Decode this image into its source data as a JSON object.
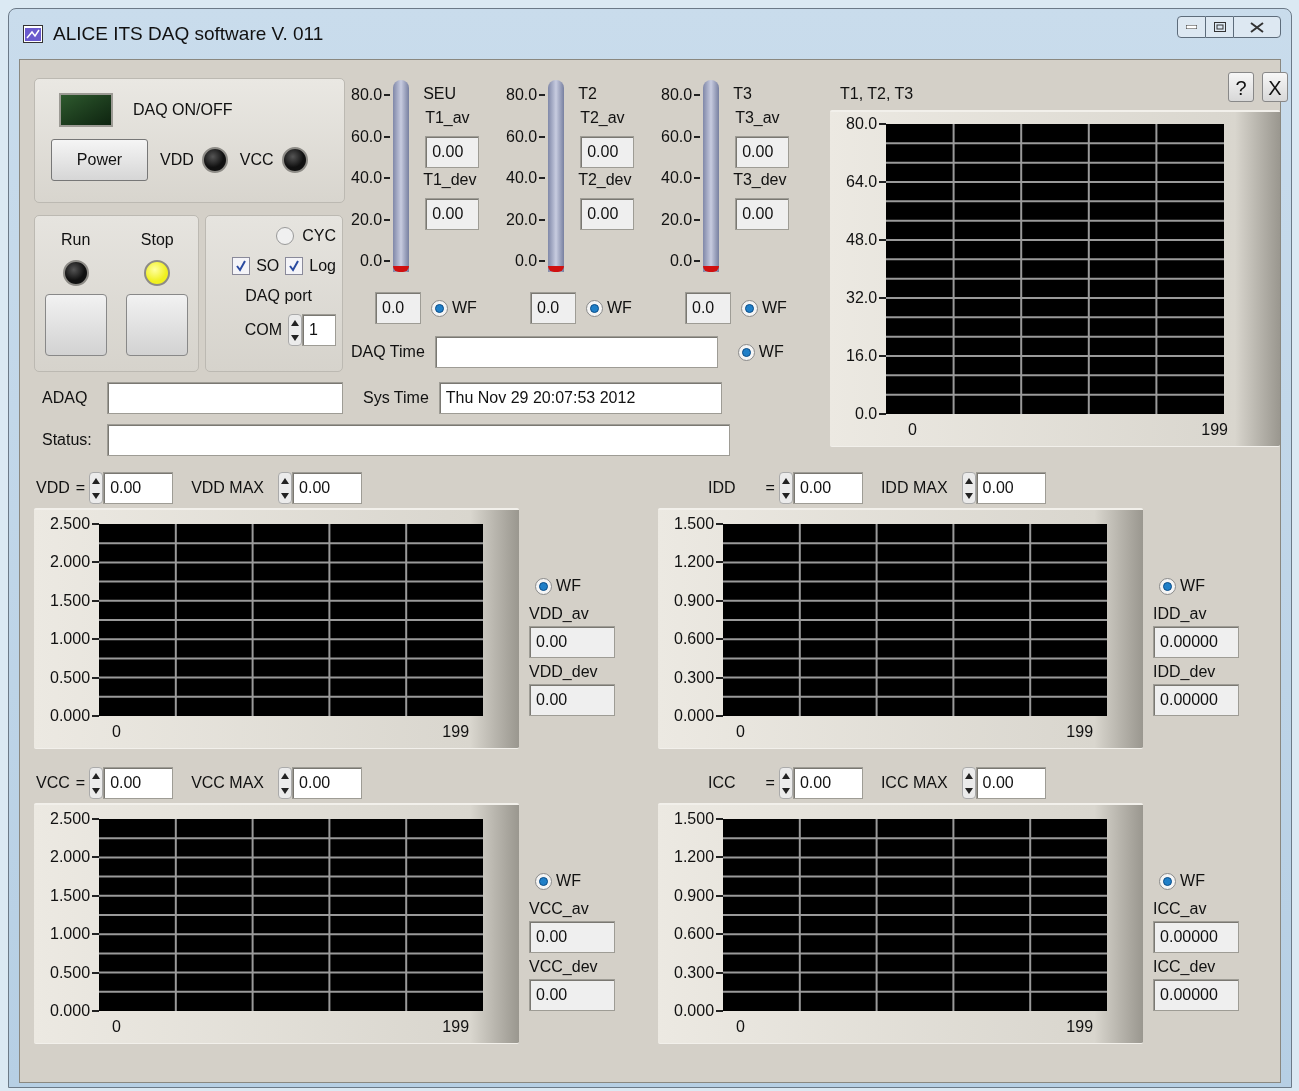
{
  "window": {
    "title": "ALICE ITS DAQ software V. 011"
  },
  "panel_buttons": [
    {
      "label": "?"
    },
    {
      "label": "X"
    }
  ],
  "daq": {
    "led_on": false,
    "label": "DAQ ON/OFF",
    "power_button": "Power",
    "indicators": [
      {
        "label": "VDD",
        "on": false
      },
      {
        "label": "VCC",
        "on": false
      }
    ]
  },
  "run_stop": [
    {
      "label": "Run",
      "lit": false
    },
    {
      "label": "Stop",
      "lit": true
    }
  ],
  "options": {
    "cyc": {
      "label": "CYC",
      "selected": false
    },
    "checkboxes": [
      {
        "label": "SO",
        "checked": true
      },
      {
        "label": "Log",
        "checked": true
      }
    ],
    "port_label": "DAQ port",
    "port_prefix": "COM",
    "port_value": "1"
  },
  "thermometers": [
    {
      "scale": [
        "80.0",
        "60.0",
        "40.0",
        "20.0",
        "0.0"
      ],
      "title": "SEU",
      "av_label": "T1_av",
      "av": "0.00",
      "dev_label": "T1_dev",
      "dev": "0.00",
      "level": 0,
      "reading": "0.0",
      "wf": {
        "label": "WF",
        "selected": true
      }
    },
    {
      "scale": [
        "80.0",
        "60.0",
        "40.0",
        "20.0",
        "0.0"
      ],
      "title": "T2",
      "av_label": "T2_av",
      "av": "0.00",
      "dev_label": "T2_dev",
      "dev": "0.00",
      "level": 0,
      "reading": "0.0",
      "wf": {
        "label": "WF",
        "selected": true
      }
    },
    {
      "scale": [
        "80.0",
        "60.0",
        "40.0",
        "20.0",
        "0.0"
      ],
      "title": "T3",
      "av_label": "T3_av",
      "av": "0.00",
      "dev_label": "T3_dev",
      "dev": "0.00",
      "level": 0,
      "reading": "0.0",
      "wf": {
        "label": "WF",
        "selected": true
      }
    }
  ],
  "daq_time": {
    "label": "DAQ Time",
    "wf": {
      "label": "WF",
      "selected": true
    }
  },
  "adaq": {
    "label": "ADAQ"
  },
  "sys_time": {
    "label": "Sys Time",
    "value": "Thu Nov 29 20:07:53 2012"
  },
  "status": {
    "label": "Status:"
  },
  "temp_chart": {
    "title": "T1, T2, T3",
    "yticks": [
      "80.0",
      "64.0",
      "48.0",
      "32.0",
      "16.0",
      "0.0"
    ],
    "xticks": [
      "0",
      "199"
    ]
  },
  "graphs": [
    {
      "label": "VDD",
      "eq": "=",
      "value": "0.00",
      "max_label": "VDD MAX",
      "max": "0.00",
      "yticks": [
        "2.500",
        "2.000",
        "1.500",
        "1.000",
        "0.500",
        "0.000"
      ],
      "xticks": [
        "0",
        "199"
      ],
      "wf": {
        "label": "WF",
        "selected": true
      },
      "av_label": "VDD_av",
      "av": "0.00",
      "dev_label": "VDD_dev",
      "dev": "0.00"
    },
    {
      "label": "IDD",
      "eq": "=",
      "value": "0.00",
      "max_label": "IDD MAX",
      "max": "0.00",
      "yticks": [
        "1.500",
        "1.200",
        "0.900",
        "0.600",
        "0.300",
        "0.000"
      ],
      "xticks": [
        "0",
        "199"
      ],
      "wf": {
        "label": "WF",
        "selected": true
      },
      "av_label": "IDD_av",
      "av": "0.00000",
      "dev_label": "IDD_dev",
      "dev": "0.00000"
    },
    {
      "label": "VCC",
      "eq": "=",
      "value": "0.00",
      "max_label": "VCC MAX",
      "max": "0.00",
      "yticks": [
        "2.500",
        "2.000",
        "1.500",
        "1.000",
        "0.500",
        "0.000"
      ],
      "xticks": [
        "0",
        "199"
      ],
      "wf": {
        "label": "WF",
        "selected": true
      },
      "av_label": "VCC_av",
      "av": "0.00",
      "dev_label": "VCC_dev",
      "dev": "0.00"
    },
    {
      "label": "ICC",
      "eq": "=",
      "value": "0.00",
      "max_label": "ICC MAX",
      "max": "0.00",
      "yticks": [
        "1.500",
        "1.200",
        "0.900",
        "0.600",
        "0.300",
        "0.000"
      ],
      "xticks": [
        "0",
        "199"
      ],
      "wf": {
        "label": "WF",
        "selected": true
      },
      "av_label": "ICC_av",
      "av": "0.00000",
      "dev_label": "ICC_dev",
      "dev": "0.00000"
    }
  ]
}
